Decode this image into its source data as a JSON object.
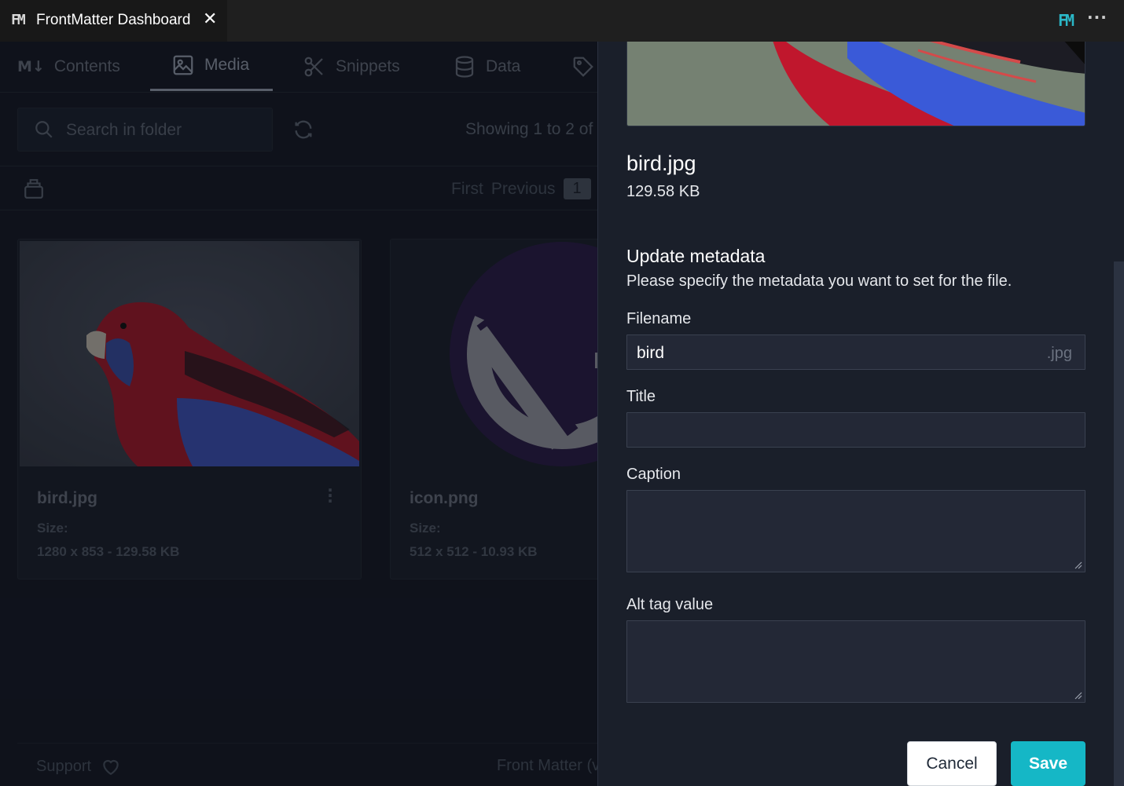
{
  "titlebar": {
    "tab_logo": "FM",
    "tab_title": "FrontMatter Dashboard",
    "close_glyph": "✕",
    "right_logo": "FM",
    "more_glyph": "···",
    "accent_color": "#2bb8c8"
  },
  "nav": {
    "markdown_badge": "M↓",
    "items": [
      {
        "label": "Contents",
        "icon": "markdown-icon"
      },
      {
        "label": "Media",
        "icon": "image-icon",
        "active": true
      },
      {
        "label": "Snippets",
        "icon": "scissors-icon"
      },
      {
        "label": "Data",
        "icon": "database-icon"
      },
      {
        "label": "",
        "icon": "tag-icon"
      }
    ]
  },
  "toolbar": {
    "search_placeholder": "Search in folder",
    "showing_text": "Showing 1 to 2 of"
  },
  "pager": {
    "first": "First",
    "previous": "Previous",
    "page": "1"
  },
  "media": [
    {
      "name": "bird.jpg",
      "size_label": "Size:",
      "size_value": "1280 x 853 - 129.58 KB"
    },
    {
      "name": "icon.png",
      "size_label": "Size:",
      "size_value": "512 x 512 - 10.93 KB"
    }
  ],
  "footer": {
    "support": "Support",
    "version": "Front Matter (v"
  },
  "panel": {
    "filename": "bird.jpg",
    "filesize": "129.58 KB",
    "heading": "Update metadata",
    "description": "Please specify the metadata you want to set for the file.",
    "fields": {
      "filename_label": "Filename",
      "filename_value": "bird",
      "filename_ext": ".jpg",
      "title_label": "Title",
      "title_value": "",
      "caption_label": "Caption",
      "caption_value": "",
      "alt_label": "Alt tag value",
      "alt_value": ""
    },
    "cancel_label": "Cancel",
    "save_label": "Save",
    "save_color": "#15b7c6"
  }
}
